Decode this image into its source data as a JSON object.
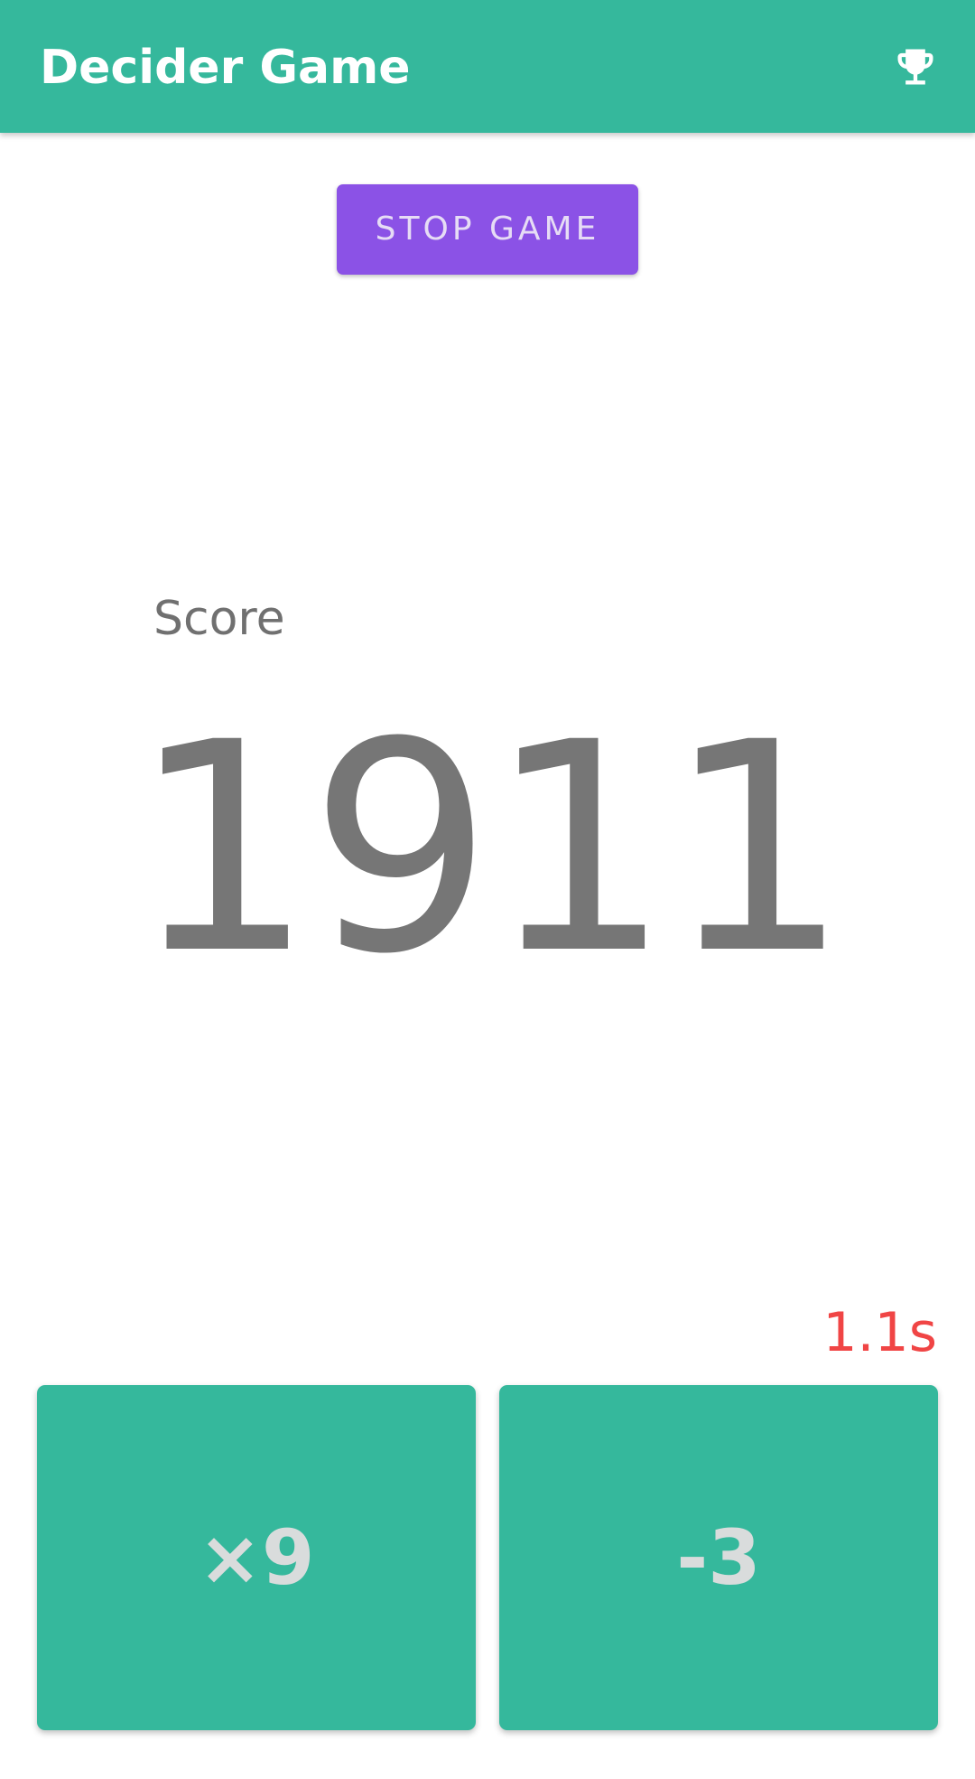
{
  "app_bar": {
    "title": "Decider Game",
    "action_icon": "trophy-icon",
    "background_color": "#35b89c"
  },
  "controls": {
    "stop_label": "STOP GAME",
    "stop_color": "#8b52e6"
  },
  "score": {
    "label": "Score",
    "value": "1911"
  },
  "timer": {
    "text": "1.1s",
    "color": "#f04545"
  },
  "choices": [
    {
      "label": "×9"
    },
    {
      "label": "-3"
    }
  ]
}
